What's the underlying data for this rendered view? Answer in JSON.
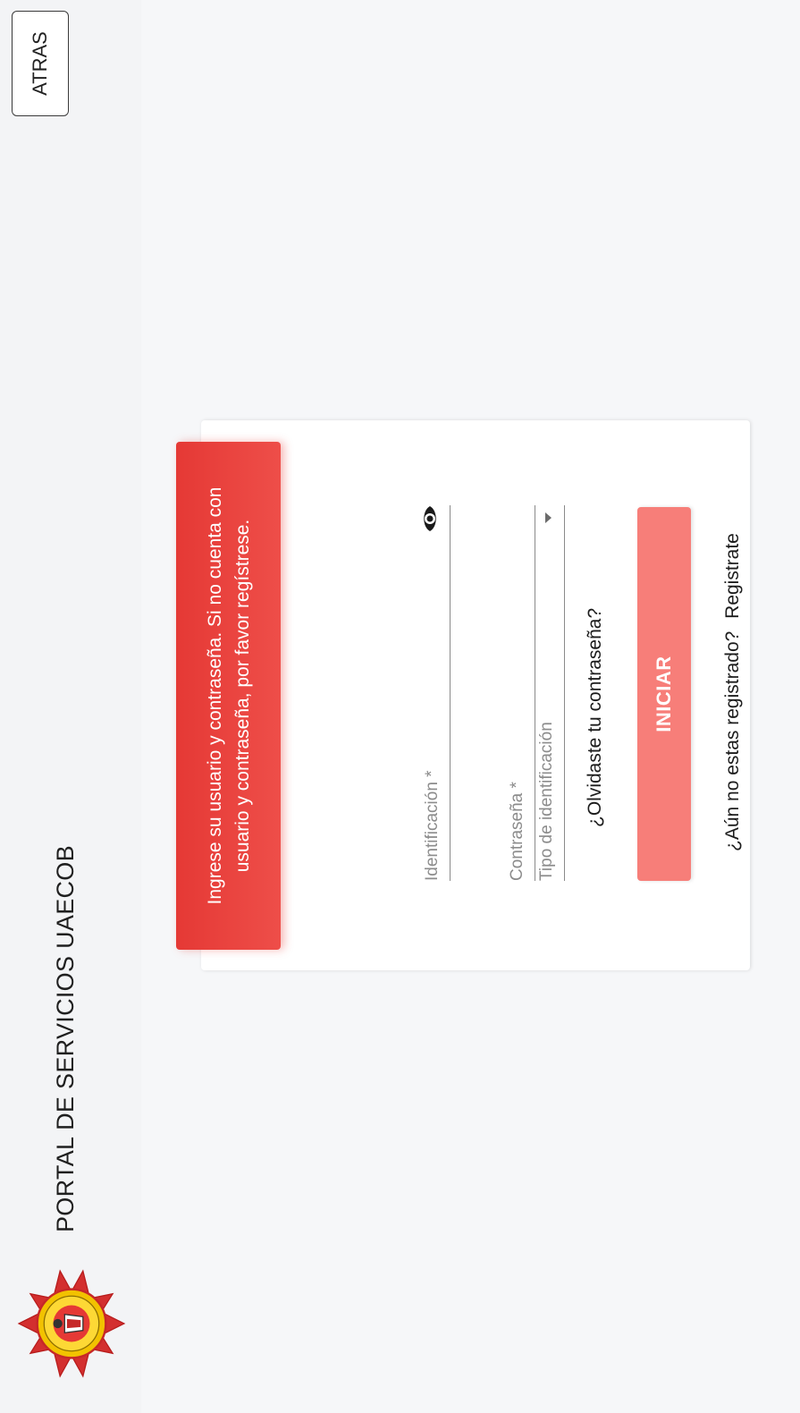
{
  "header": {
    "title": "PORTAL DE SERVICIOS UAECOB",
    "back_label": "ATRAS",
    "logo_icon": "fire-department-badge-icon"
  },
  "login": {
    "alert_text": "Ingrese su usuario y contraseña. Si no cuenta con usuario y contraseña, por favor regístrese.",
    "id_type_label": "Tipo de identificación",
    "id_label": "Identificación *",
    "password_label": "Contraseña *",
    "forgot_link": "¿Olvidaste tu contraseña?",
    "submit_label": "INICIAR",
    "register_prompt": "¿Aún no estas registrado?",
    "register_link": "Registrate"
  },
  "colors": {
    "alert": "#e53935",
    "button": "#f77e79",
    "badge_red": "#d32f2f",
    "badge_gold": "#f2c200"
  }
}
